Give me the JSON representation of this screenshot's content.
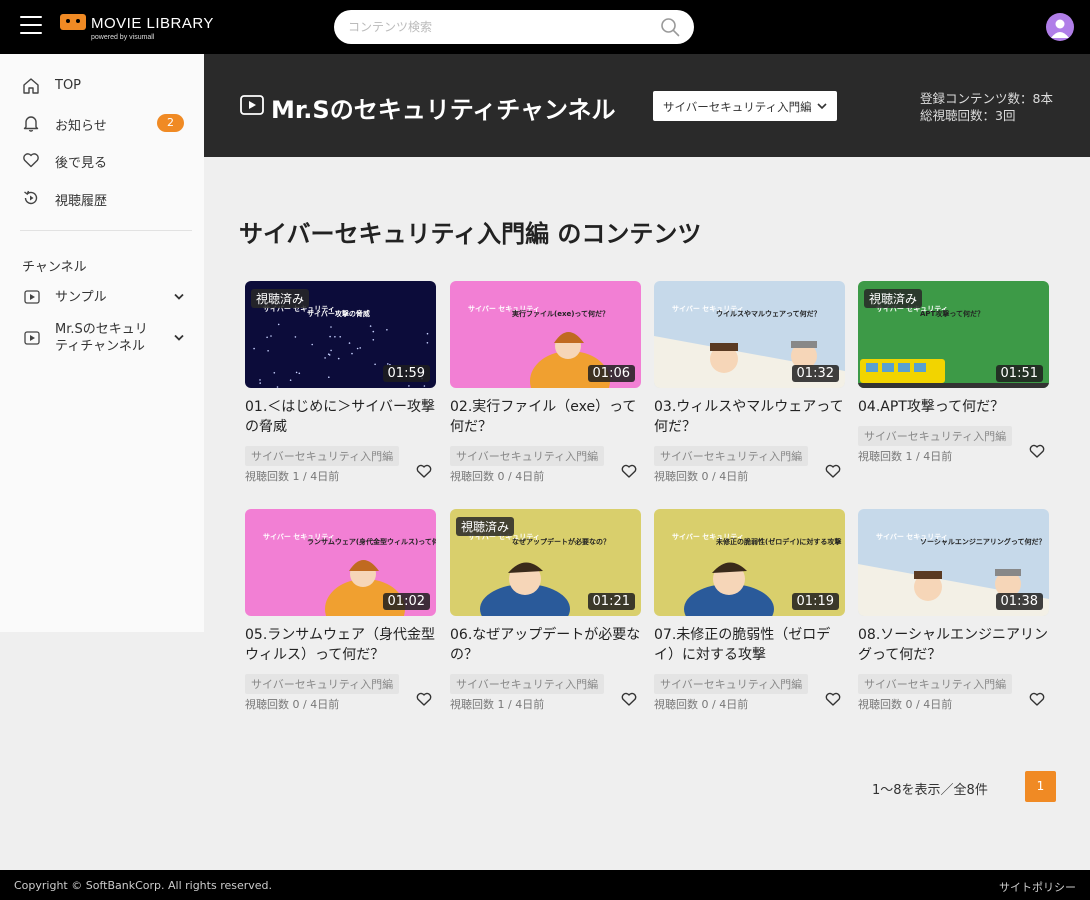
{
  "header": {
    "logo_text": "MOVIE LIBRARY",
    "logo_sub": "powered by visumall",
    "search_placeholder": "コンテンツ検索"
  },
  "sidebar": {
    "items": [
      {
        "label": "TOP",
        "icon": "home-icon"
      },
      {
        "label": "お知らせ",
        "icon": "bell-icon",
        "badge": "2"
      },
      {
        "label": "後で見る",
        "icon": "heart-icon"
      },
      {
        "label": "視聴履歴",
        "icon": "history-icon"
      }
    ],
    "section_title": "チャンネル",
    "channels": [
      {
        "label": "サンプル"
      },
      {
        "label": "Mr.Sのセキュリティチャンネル"
      }
    ]
  },
  "channel_header": {
    "title": "Mr.Sのセキュリティチャンネル",
    "select_value": "サイバーセキュリティ入門編",
    "stat_contents": "登録コンテンツ数：8本",
    "stat_views": "総視聴回数：3回"
  },
  "main": {
    "title": "サイバーセキュリティ入門編 のコンテンツ"
  },
  "videos": [
    {
      "title": "01.＜はじめに＞サイバー攻撃の脅威",
      "duration": "01:59",
      "watched": true,
      "tag": "サイバーセキュリティ入門編",
      "views": "視聴回数 1",
      "age": "4日前",
      "thumb_caption": "サイバー攻撃の脅威",
      "thumb_color": "#0c0c3a"
    },
    {
      "title": "02.実行ファイル（exe）って何だ？",
      "duration": "01:06",
      "watched": false,
      "tag": "サイバーセキュリティ入門編",
      "views": "視聴回数 0",
      "age": "4日前",
      "thumb_caption": "実行ファイル(exe)って何だ？",
      "thumb_color": "#f27fd4"
    },
    {
      "title": "03.ウィルスやマルウェアって何だ？",
      "duration": "01:32",
      "watched": false,
      "tag": "サイバーセキュリティ入門編",
      "views": "視聴回数 0",
      "age": "4日前",
      "thumb_caption": "ウイルスやマルウェアって何だ？",
      "thumb_color": "#c6d9ea"
    },
    {
      "title": "04.APT攻撃って何だ？",
      "duration": "01:51",
      "watched": true,
      "tag": "サイバーセキュリティ入門編",
      "views": "視聴回数 1",
      "age": "4日前",
      "thumb_caption": "APT攻撃って何だ？",
      "thumb_color": "#3d9a47"
    },
    {
      "title": "05.ランサムウェア（身代金型ウィルス）って何だ？",
      "duration": "01:02",
      "watched": false,
      "tag": "サイバーセキュリティ入門編",
      "views": "視聴回数 0",
      "age": "4日前",
      "thumb_caption": "ランサムウェア(身代金型ウィルス)って何だ？",
      "thumb_color": "#f27fd4"
    },
    {
      "title": "06.なぜアップデートが必要なの？",
      "duration": "01:21",
      "watched": true,
      "tag": "サイバーセキュリティ入門編",
      "views": "視聴回数 1",
      "age": "4日前",
      "thumb_caption": "なぜアップデートが必要なの？",
      "thumb_color": "#d9cf6c"
    },
    {
      "title": "07.未修正の脆弱性（ゼロデイ）に対する攻撃",
      "duration": "01:19",
      "watched": false,
      "tag": "サイバーセキュリティ入門編",
      "views": "視聴回数 0",
      "age": "4日前",
      "thumb_caption": "未修正の脆弱性(ゼロデイ)に対する攻撃",
      "thumb_color": "#d9cf6c"
    },
    {
      "title": "08.ソーシャルエンジニアリングって何だ？",
      "duration": "01:38",
      "watched": false,
      "tag": "サイバーセキュリティ入門編",
      "views": "視聴回数 0",
      "age": "4日前",
      "thumb_caption": "ソーシャルエンジニアリングって何だ？",
      "thumb_color": "#c6d9ea"
    }
  ],
  "video_labels": {
    "watched_badge": "視聴済み",
    "thumb_brand": "サイバー セキュリティ",
    "meta_separator": " / "
  },
  "pagination": {
    "summary": "1〜8を表示／全8件",
    "current_page": "1"
  },
  "footer": {
    "copyright": "Copyright © SoftBankCorp. All rights reserved.",
    "policy": "サイトポリシー"
  },
  "colors": {
    "accent": "#f08a24",
    "header_bg": "#000000",
    "channel_header_bg": "#2a2a2a",
    "avatar": "#b07ee8"
  }
}
